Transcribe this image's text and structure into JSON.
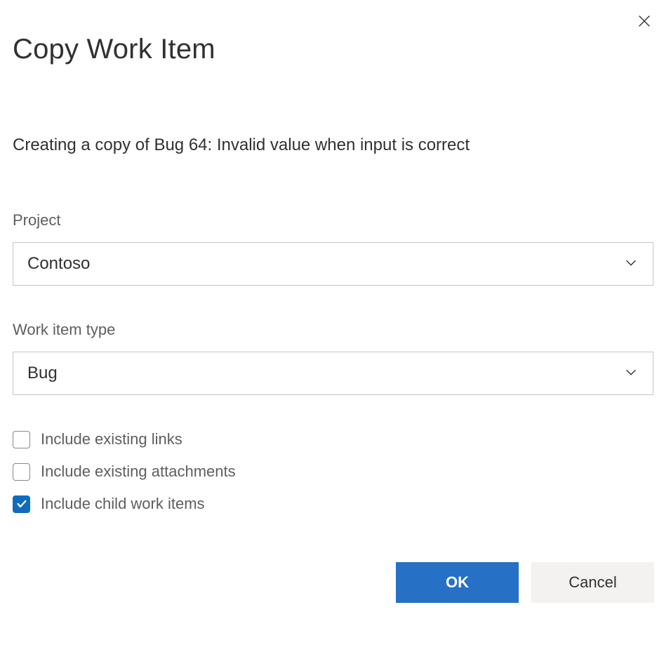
{
  "dialog": {
    "title": "Copy Work Item",
    "description": "Creating a copy of Bug 64: Invalid value when input is correct"
  },
  "fields": {
    "project": {
      "label": "Project",
      "value": "Contoso"
    },
    "workItemType": {
      "label": "Work item type",
      "value": "Bug"
    }
  },
  "checkboxes": {
    "includeLinks": {
      "label": "Include existing links",
      "checked": false
    },
    "includeAttachments": {
      "label": "Include existing attachments",
      "checked": false
    },
    "includeChildren": {
      "label": "Include child work items",
      "checked": true
    }
  },
  "buttons": {
    "ok": "OK",
    "cancel": "Cancel"
  }
}
